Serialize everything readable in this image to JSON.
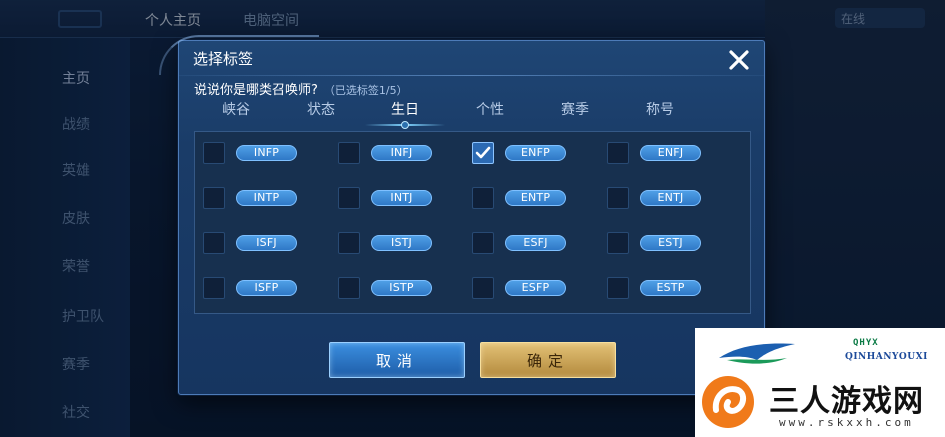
{
  "background": {
    "top_tabs": [
      "个人主页",
      "电脑空间"
    ],
    "sidebar_items": [
      "主页",
      "战绩",
      "英雄",
      "皮肤",
      "荣誉",
      "护卫队",
      "赛季",
      "社交"
    ],
    "right_label": "在线"
  },
  "dialog": {
    "title": "选择标签",
    "question": "说说你是哪类召唤师?",
    "selected_count": "（已选标签1/5）",
    "tabs": [
      {
        "label": "峡谷",
        "active": false
      },
      {
        "label": "状态",
        "active": false
      },
      {
        "label": "生日",
        "active": true
      },
      {
        "label": "个性",
        "active": false
      },
      {
        "label": "赛季",
        "active": false
      },
      {
        "label": "称号",
        "active": false
      }
    ],
    "tags": [
      {
        "label": "INFP",
        "checked": false
      },
      {
        "label": "INFJ",
        "checked": false
      },
      {
        "label": "ENFP",
        "checked": true
      },
      {
        "label": "ENFJ",
        "checked": false
      },
      {
        "label": "INTP",
        "checked": false
      },
      {
        "label": "INTJ",
        "checked": false
      },
      {
        "label": "ENTP",
        "checked": false
      },
      {
        "label": "ENTJ",
        "checked": false
      },
      {
        "label": "ISFJ",
        "checked": false
      },
      {
        "label": "ISTJ",
        "checked": false
      },
      {
        "label": "ESFJ",
        "checked": false
      },
      {
        "label": "ESTJ",
        "checked": false
      },
      {
        "label": "ISFP",
        "checked": false
      },
      {
        "label": "ISTP",
        "checked": false
      },
      {
        "label": "ESFP",
        "checked": false
      },
      {
        "label": "ESTP",
        "checked": false
      }
    ],
    "cancel_label": "取消",
    "confirm_label": "确定",
    "close_icon": "close-icon",
    "check_icon": "checkmark-icon"
  },
  "watermark": {
    "brand": "三人游戏网",
    "url": "www.rskxxh.com",
    "sub": "QINHANYOUXI",
    "sub_box": "QHYX"
  },
  "colors": {
    "dialog_bg": "#1a3c68",
    "pill": "#2f78c6",
    "cancel_btn": "#1e5da8",
    "confirm_btn": "#b38a3d",
    "logo_orange": "#f07a1a"
  }
}
